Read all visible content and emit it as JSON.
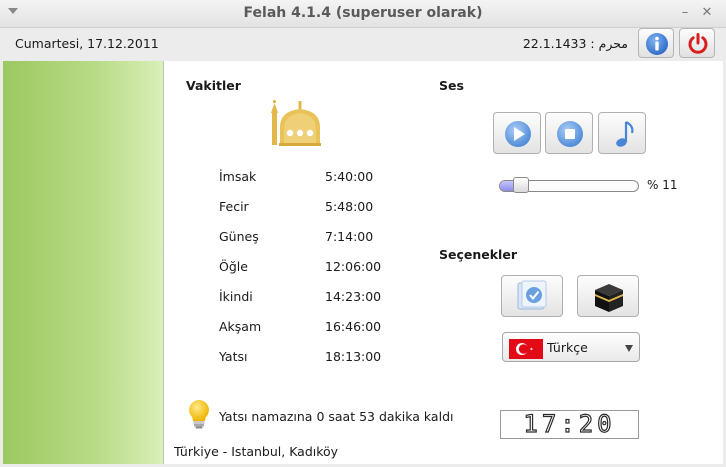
{
  "window": {
    "title": "Felah 4.1.4 (superuser olarak)"
  },
  "header": {
    "gregorian_date": "Cumartesi, 17.12.2011",
    "hijri_date": "22.1.1433 : محرم"
  },
  "icons": {
    "info": "info-icon",
    "power": "power-icon",
    "mosque": "mosque-icon",
    "play": "play-icon",
    "stop": "stop-icon",
    "music": "music-note-icon",
    "check": "checkmark-icon",
    "kaaba": "kaaba-icon",
    "bulb": "lightbulb-icon"
  },
  "times": {
    "title": "Vakitler",
    "prayers": [
      {
        "name": "İmsak",
        "time": "5:40:00"
      },
      {
        "name": "Fecir",
        "time": "5:48:00"
      },
      {
        "name": "Güneş",
        "time": "7:14:00"
      },
      {
        "name": "Öğle",
        "time": "12:06:00"
      },
      {
        "name": "İkindi",
        "time": "14:23:00"
      },
      {
        "name": "Akşam",
        "time": "16:46:00"
      },
      {
        "name": "Yatsı",
        "time": "18:13:00"
      }
    ]
  },
  "sound": {
    "title": "Ses",
    "volume_label": "% 11",
    "volume_fraction": 0.11
  },
  "options": {
    "title": "Seçenekler",
    "language": "Türkçe"
  },
  "clock": "17:20",
  "hint": "Yatsı namazına 0 saat 53 dakika kaldı",
  "location": "Türkiye - Istanbul, Kadıköy",
  "colors": {
    "sidebar_green": "#b7da84",
    "accent_blue": "#3d7fd9",
    "power_red": "#d62020",
    "gold": "#e2b84a",
    "flag_red": "#e30a17"
  }
}
